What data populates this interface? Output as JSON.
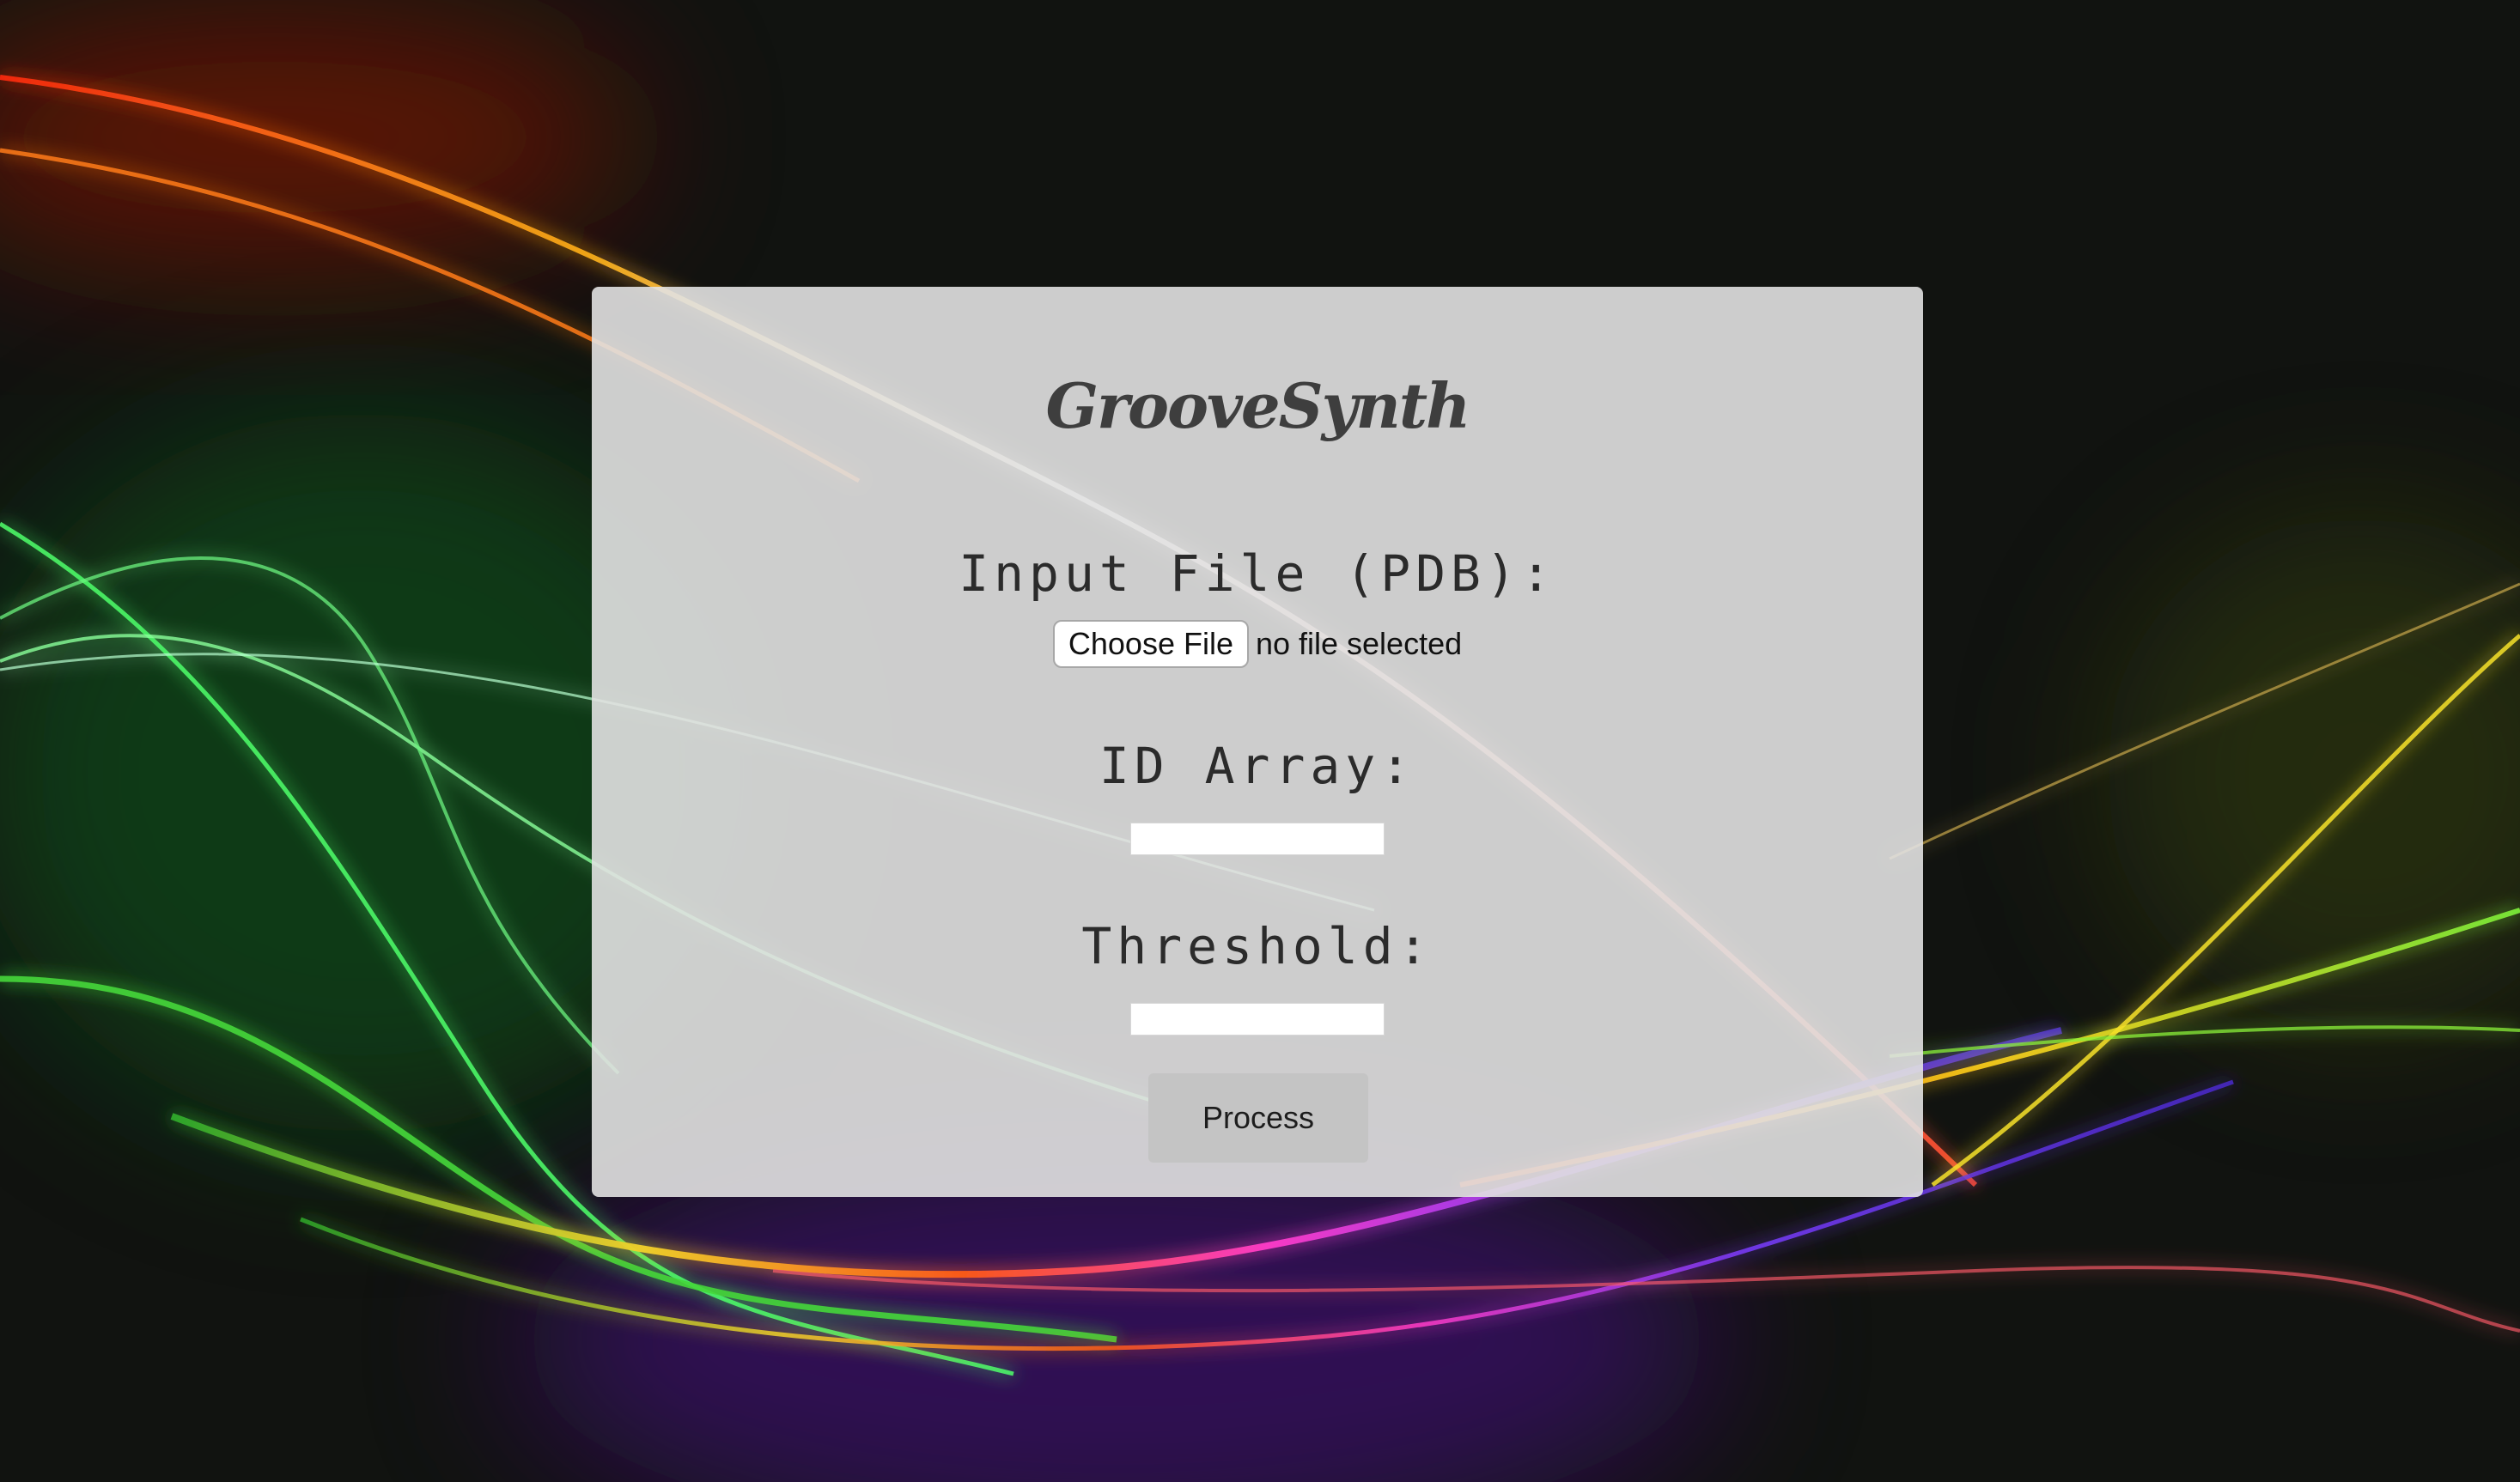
{
  "app": {
    "logo_text": "GrooveSynth"
  },
  "form": {
    "input_file_label": "Input File (PDB):",
    "choose_file_label": "Choose File",
    "file_status": "no file selected",
    "id_array_label": "ID Array:",
    "id_array_value": "",
    "threshold_label": "Threshold:",
    "threshold_value": "",
    "process_label": "Process"
  },
  "colors": {
    "page_background": "#111310",
    "panel_background": "#e2e2e2",
    "process_button": "#c4c4c4",
    "logo_text": "#3e3e3e"
  }
}
